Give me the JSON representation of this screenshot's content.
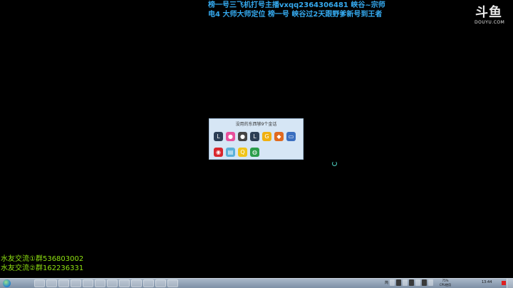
{
  "stream_overlay": {
    "line1": "榜一号三飞机打号主播vxqq2364306481   峡谷~宗师",
    "line2": "电4 大师大师定位 榜一号  峡谷过2天跟野爹新号到王者",
    "chat1": "水友交流①群536803002",
    "chat2": "水友交流②群162236331"
  },
  "logo": {
    "mark": "斗鱼",
    "sub": "DOUYU.COM"
  },
  "popup": {
    "title": "没用的东西够9个金话",
    "row1": [
      {
        "icon": "lol-icon",
        "glyph": "L",
        "color": "#2c3e55"
      },
      {
        "icon": "color-wheel-icon",
        "glyph": "●",
        "color": "#e84f9c"
      },
      {
        "icon": "game-avatar-icon",
        "glyph": "●",
        "color": "#444"
      },
      {
        "icon": "lol-icon-2",
        "glyph": "L",
        "color": "#2c3e55"
      },
      {
        "icon": "yy-icon",
        "glyph": "G",
        "color": "#f0b010"
      },
      {
        "icon": "tool-icon",
        "glyph": "◆",
        "color": "#e06a1f"
      },
      {
        "icon": "monitor-icon",
        "glyph": "▭",
        "color": "#3a6fc0"
      }
    ],
    "row2": [
      {
        "icon": "netease-music-icon",
        "glyph": "◉",
        "color": "#d8262c"
      },
      {
        "icon": "folder-icon",
        "glyph": "▤",
        "color": "#5ab0d8"
      },
      {
        "icon": "qq-icon",
        "glyph": "Q",
        "color": "#f0c419"
      },
      {
        "icon": "chrome-icon",
        "glyph": "◍",
        "color": "#2a9d4a"
      }
    ]
  },
  "taskbar": {
    "buttons": [
      "",
      "",
      "",
      "",
      "",
      "",
      "",
      "",
      "",
      "",
      "",
      ""
    ],
    "cpu_line1": "75%",
    "cpu_line2": "CPU使用",
    "clock": "13:44",
    "tray_label": "简"
  }
}
